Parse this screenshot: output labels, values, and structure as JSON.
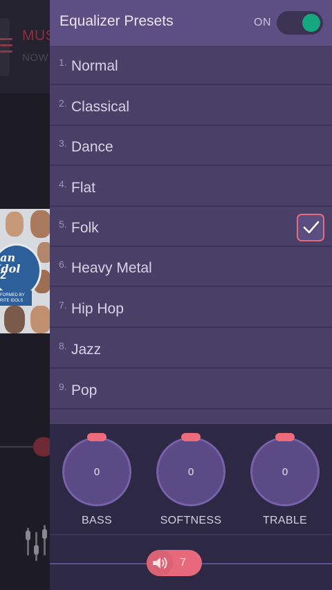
{
  "background_app": {
    "title": "MUS",
    "subtitle": "NOW",
    "album_logo_text": "ian\nIdol",
    "album_logo_num": "2",
    "album_strip_text": "FORMED BY\nRITE IDOLS"
  },
  "drawer": {
    "title": "Equalizer Presets",
    "toggle_label": "ON",
    "toggle_state": "on"
  },
  "presets": [
    {
      "num": "1.",
      "name": "Normal"
    },
    {
      "num": "2.",
      "name": "Classical"
    },
    {
      "num": "3.",
      "name": "Dance"
    },
    {
      "num": "4.",
      "name": "Flat"
    },
    {
      "num": "5.",
      "name": "Folk"
    },
    {
      "num": "6.",
      "name": "Heavy Metal"
    },
    {
      "num": "7.",
      "name": "Hip Hop"
    },
    {
      "num": "8.",
      "name": "Jazz"
    },
    {
      "num": "9.",
      "name": "Pop"
    }
  ],
  "selected_preset": "Folk",
  "knobs": [
    {
      "label": "BASS",
      "value": "0"
    },
    {
      "label": "SOFTNESS",
      "value": "0"
    },
    {
      "label": "TRABLE",
      "value": "0"
    }
  ],
  "volume": {
    "value": "7"
  },
  "colors": {
    "accent": "#e8697b",
    "toggle_on": "#15a77e",
    "drawer_bg": "#4a3f67",
    "header_bg": "#5d4f83"
  }
}
